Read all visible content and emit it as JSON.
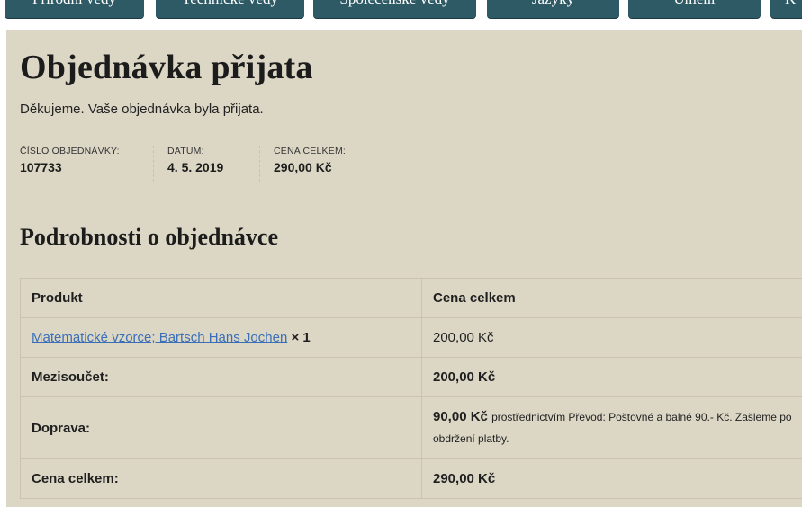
{
  "nav": {
    "tabs": [
      {
        "label": "Přírodní vědy"
      },
      {
        "label": "Technické vědy"
      },
      {
        "label": "Společenské vědy"
      },
      {
        "label": "Jazyky"
      },
      {
        "label": "Umění"
      },
      {
        "label": "K"
      }
    ]
  },
  "page": {
    "title": "Objednávka přijata",
    "thanks": "Děkujeme. Vaše objednávka byla přijata."
  },
  "overview": {
    "order_number_label": "ČÍSLO OBJEDNÁVKY:",
    "order_number": "107733",
    "date_label": "DATUM:",
    "date": "4. 5. 2019",
    "total_label": "CENA CELKEM:",
    "total": "290,00 Kč"
  },
  "details": {
    "heading": "Podrobnosti o objednávce",
    "col_product": "Produkt",
    "col_total": "Cena celkem",
    "item": {
      "name": "Matematické vzorce; Bartsch Hans Jochen",
      "qty": "× 1",
      "price": "200,00 Kč"
    },
    "subtotal_label": "Mezisoučet:",
    "subtotal": "200,00 Kč",
    "shipping_label": "Doprava:",
    "shipping_price": "90,00 Kč",
    "shipping_note": "prostřednictvím Převod: Poštovné a balné 90.- Kč. Zašleme po obdržení platby.",
    "total_label": "Cena celkem:",
    "total": "290,00 Kč"
  },
  "colors": {
    "nav_tab": "#2e5a66",
    "content_bg": "#dcd7c5",
    "link": "#3a6fb8"
  }
}
